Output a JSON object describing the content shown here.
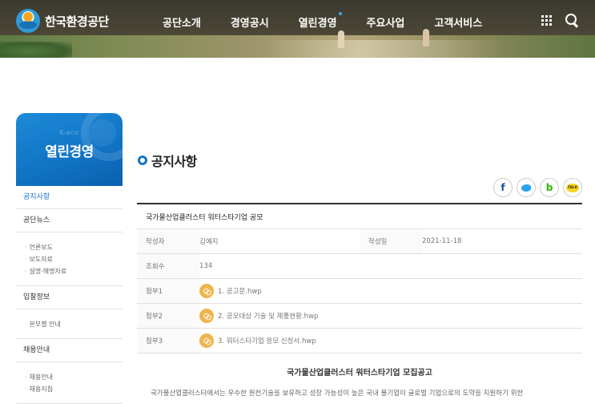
{
  "header": {
    "logo_text": "한국환경공단",
    "nav": [
      "공단소개",
      "경영공시",
      "열린경영",
      "주요사업",
      "고객서비스"
    ],
    "active_nav_index": 2
  },
  "sidebar": {
    "badge": "K-eco",
    "title": "열린경영",
    "menu": [
      {
        "label": "공지사항",
        "active": true,
        "children": []
      },
      {
        "label": "공단뉴스",
        "active": false,
        "children": [
          "언론보도",
          "보도자료",
          "설명·해명자료"
        ]
      },
      {
        "label": "입찰정보",
        "active": false,
        "children": [
          "본부별 안내"
        ]
      },
      {
        "label": "채용안내",
        "active": false,
        "children": [
          "채용안내",
          "채용지침"
        ]
      }
    ]
  },
  "content": {
    "title": "공지사항",
    "share": {
      "facebook_icon": "f",
      "twitter_icon": "twitter-bird",
      "blog_icon": "b",
      "kakao_icon": "TALK"
    },
    "post": {
      "subject": "국가물산업클러스터 워터스타기업 공모",
      "author_label": "작성자",
      "author": "김예지",
      "date_label": "작성일",
      "date": "2021-11-18",
      "views_label": "조회수",
      "views": "134",
      "attachments": [
        {
          "label": "첨부1",
          "file": "1. 공고문.hwp"
        },
        {
          "label": "첨부2",
          "file": "2. 공모대상 기술 및 제품현황.hwp"
        },
        {
          "label": "첨부3",
          "file": "3. 워터스타기업 응모 신청서.hwp"
        }
      ],
      "body_title": "국가물산업클러스터 워터스타기업 모집공고",
      "body_text": "국가물산업클러스터에서는 우수한 원천기술을 보유하고 성장 가능성이 높은 국내 물기업이 글로벌 기업으로의 도약을 지원하기 위한"
    }
  },
  "colors": {
    "accent": "#1a73c6",
    "attachment_icon": "#f0b44c"
  }
}
